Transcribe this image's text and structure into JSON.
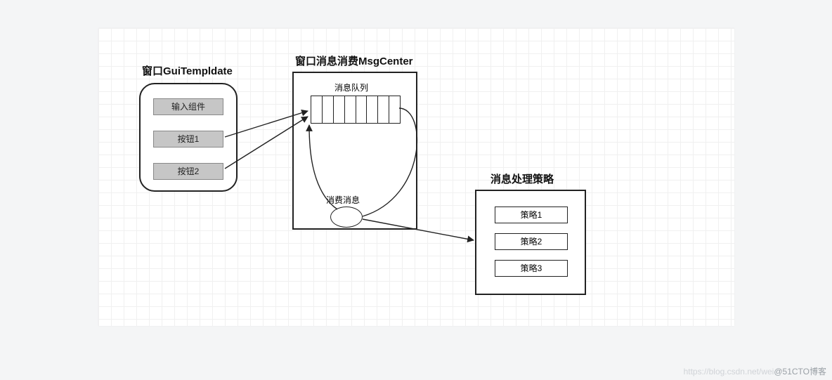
{
  "titles": {
    "gui": "窗口GuiTempldate",
    "msgCenter": "窗口消息消费MsgCenter",
    "strategy": "消息处理策略"
  },
  "gui": {
    "inputComp": "输入组件",
    "btn1": "按钮1",
    "btn2": "按钮2"
  },
  "msgCenter": {
    "queueLabel": "消息队列",
    "consumeLabel": "消费消息"
  },
  "strategies": {
    "s1": "策略1",
    "s2": "策略2",
    "s3": "策略3"
  },
  "watermark": {
    "faint": "https://blog.csdn.net/wei",
    "strong": "@51CTO博客"
  }
}
